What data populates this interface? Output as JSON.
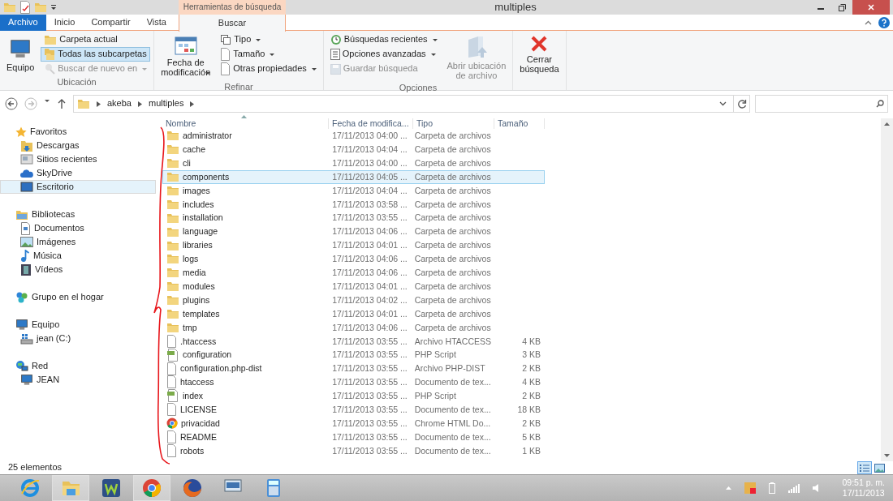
{
  "window": {
    "title": "multiples"
  },
  "ribbon": {
    "contextual_label": "Herramientas de búsqueda",
    "tabs": [
      {
        "label": "Archivo",
        "kind": "file",
        "selected": false
      },
      {
        "label": "Inicio",
        "kind": "plain",
        "selected": false
      },
      {
        "label": "Compartir",
        "kind": "plain",
        "selected": false
      },
      {
        "label": "Vista",
        "kind": "plain",
        "selected": false
      },
      {
        "label": "Buscar",
        "kind": "contextual",
        "selected": true
      }
    ],
    "groups": [
      {
        "label": "Ubicación",
        "items": [
          {
            "kind": "large",
            "label": "Equipo",
            "disabled": false,
            "dropdown": false
          },
          {
            "kind": "stack",
            "items": [
              {
                "label": "Carpeta actual",
                "selected": false,
                "disabled": false,
                "dropdown": false
              },
              {
                "label": "Todas las subcarpetas",
                "selected": true,
                "disabled": false,
                "dropdown": false
              },
              {
                "label": "Buscar de nuevo en",
                "selected": false,
                "disabled": true,
                "dropdown": true
              }
            ]
          }
        ]
      },
      {
        "label": "Refinar",
        "items": [
          {
            "kind": "large",
            "label": "Fecha de\nmodificación",
            "disabled": false,
            "dropdown": true
          },
          {
            "kind": "stack",
            "items": [
              {
                "label": "Tipo",
                "selected": false,
                "disabled": false,
                "dropdown": true
              },
              {
                "label": "Tamaño",
                "selected": false,
                "disabled": false,
                "dropdown": true
              },
              {
                "label": "Otras propiedades",
                "selected": false,
                "disabled": false,
                "dropdown": true
              }
            ]
          }
        ]
      },
      {
        "label": "Opciones",
        "items": [
          {
            "kind": "stack",
            "items": [
              {
                "label": "Búsquedas recientes",
                "selected": false,
                "disabled": false,
                "dropdown": true
              },
              {
                "label": "Opciones avanzadas",
                "selected": false,
                "disabled": false,
                "dropdown": true
              },
              {
                "label": "Guardar búsqueda",
                "selected": false,
                "disabled": true,
                "dropdown": false
              }
            ]
          },
          {
            "kind": "large",
            "label": "Abrir ubicación\nde archivo",
            "disabled": true,
            "dropdown": false
          }
        ]
      },
      {
        "items": [
          {
            "kind": "large",
            "label": "Cerrar\nbúsqueda",
            "disabled": false,
            "dropdown": false
          }
        ]
      }
    ]
  },
  "address": {
    "path": [
      "akeba",
      "multiples"
    ]
  },
  "navigation": [
    {
      "label": "Favoritos",
      "selected": false,
      "children": [
        {
          "label": "Descargas",
          "selected": false
        },
        {
          "label": "Sitios recientes",
          "selected": false
        },
        {
          "label": "SkyDrive",
          "selected": false
        },
        {
          "label": "Escritorio",
          "selected": true
        }
      ]
    },
    {
      "label": "Bibliotecas",
      "selected": false,
      "children": [
        {
          "label": "Documentos",
          "selected": false
        },
        {
          "label": "Imágenes",
          "selected": false
        },
        {
          "label": "Música",
          "selected": false
        },
        {
          "label": "Vídeos",
          "selected": false
        }
      ]
    },
    {
      "label": "Grupo en el hogar",
      "selected": false
    },
    {
      "label": "Equipo",
      "selected": false,
      "children": [
        {
          "label": "jean (C:)",
          "selected": false
        }
      ]
    },
    {
      "label": "Red",
      "selected": false,
      "children": [
        {
          "label": "JEAN",
          "selected": false
        }
      ]
    }
  ],
  "table": {
    "columns": [
      "Nombre",
      "Fecha de modifica...",
      "Tipo",
      "Tamaño"
    ],
    "rows": [
      {
        "kind": "folder",
        "name": "administrator",
        "date": "17/11/2013 04:00 ...",
        "type": "Carpeta de archivos",
        "size": "",
        "selected": false
      },
      {
        "kind": "folder",
        "name": "cache",
        "date": "17/11/2013 04:04 ...",
        "type": "Carpeta de archivos",
        "size": "",
        "selected": false
      },
      {
        "kind": "folder",
        "name": "cli",
        "date": "17/11/2013 04:00 ...",
        "type": "Carpeta de archivos",
        "size": "",
        "selected": false
      },
      {
        "kind": "folder",
        "name": "components",
        "date": "17/11/2013 04:05 ...",
        "type": "Carpeta de archivos",
        "size": "",
        "selected": true
      },
      {
        "kind": "folder",
        "name": "images",
        "date": "17/11/2013 04:04 ...",
        "type": "Carpeta de archivos",
        "size": "",
        "selected": false
      },
      {
        "kind": "folder",
        "name": "includes",
        "date": "17/11/2013 03:58 ...",
        "type": "Carpeta de archivos",
        "size": "",
        "selected": false
      },
      {
        "kind": "folder",
        "name": "installation",
        "date": "17/11/2013 03:55 ...",
        "type": "Carpeta de archivos",
        "size": "",
        "selected": false
      },
      {
        "kind": "folder",
        "name": "language",
        "date": "17/11/2013 04:06 ...",
        "type": "Carpeta de archivos",
        "size": "",
        "selected": false
      },
      {
        "kind": "folder",
        "name": "libraries",
        "date": "17/11/2013 04:01 ...",
        "type": "Carpeta de archivos",
        "size": "",
        "selected": false
      },
      {
        "kind": "folder",
        "name": "logs",
        "date": "17/11/2013 04:06 ...",
        "type": "Carpeta de archivos",
        "size": "",
        "selected": false
      },
      {
        "kind": "folder",
        "name": "media",
        "date": "17/11/2013 04:06 ...",
        "type": "Carpeta de archivos",
        "size": "",
        "selected": false
      },
      {
        "kind": "folder",
        "name": "modules",
        "date": "17/11/2013 04:01 ...",
        "type": "Carpeta de archivos",
        "size": "",
        "selected": false
      },
      {
        "kind": "folder",
        "name": "plugins",
        "date": "17/11/2013 04:02 ...",
        "type": "Carpeta de archivos",
        "size": "",
        "selected": false
      },
      {
        "kind": "folder",
        "name": "templates",
        "date": "17/11/2013 04:01 ...",
        "type": "Carpeta de archivos",
        "size": "",
        "selected": false
      },
      {
        "kind": "folder",
        "name": "tmp",
        "date": "17/11/2013 04:06 ...",
        "type": "Carpeta de archivos",
        "size": "",
        "selected": false
      },
      {
        "kind": "file",
        "name": ".htaccess",
        "date": "17/11/2013 03:55 ...",
        "type": "Archivo HTACCESS",
        "size": "4 KB",
        "selected": false
      },
      {
        "kind": "php",
        "name": "configuration",
        "date": "17/11/2013 03:55 ...",
        "type": "PHP Script",
        "size": "3 KB",
        "selected": false
      },
      {
        "kind": "file",
        "name": "configuration.php-dist",
        "date": "17/11/2013 03:55 ...",
        "type": "Archivo PHP-DIST",
        "size": "2 KB",
        "selected": false
      },
      {
        "kind": "file",
        "name": "htaccess",
        "date": "17/11/2013 03:55 ...",
        "type": "Documento de tex...",
        "size": "4 KB",
        "selected": false
      },
      {
        "kind": "php",
        "name": "index",
        "date": "17/11/2013 03:55 ...",
        "type": "PHP Script",
        "size": "2 KB",
        "selected": false
      },
      {
        "kind": "file",
        "name": "LICENSE",
        "date": "17/11/2013 03:55 ...",
        "type": "Documento de tex...",
        "size": "18 KB",
        "selected": false
      },
      {
        "kind": "chrome",
        "name": "privacidad",
        "date": "17/11/2013 03:55 ...",
        "type": "Chrome HTML Do...",
        "size": "2 KB",
        "selected": false
      },
      {
        "kind": "file",
        "name": "README",
        "date": "17/11/2013 03:55 ...",
        "type": "Documento de tex...",
        "size": "5 KB",
        "selected": false
      },
      {
        "kind": "file",
        "name": "robots",
        "date": "17/11/2013 03:55 ...",
        "type": "Documento de tex...",
        "size": "1 KB",
        "selected": false
      }
    ]
  },
  "status_bar": {
    "count": "25 elementos",
    "views": [
      {
        "kind": "details",
        "selected": true
      },
      {
        "kind": "large",
        "selected": false
      }
    ]
  },
  "taskbar": {
    "apps": [
      {
        "kind": "ie",
        "selected": false
      },
      {
        "kind": "explorer",
        "selected": true
      },
      {
        "kind": "w",
        "selected": false
      },
      {
        "kind": "chrome",
        "selected": true
      },
      {
        "kind": "firefox",
        "selected": false
      },
      {
        "kind": "keyboard",
        "selected": false
      },
      {
        "kind": "calculator",
        "selected": false
      }
    ],
    "time": "09:51 p. m.",
    "date": "17/11/2013"
  }
}
